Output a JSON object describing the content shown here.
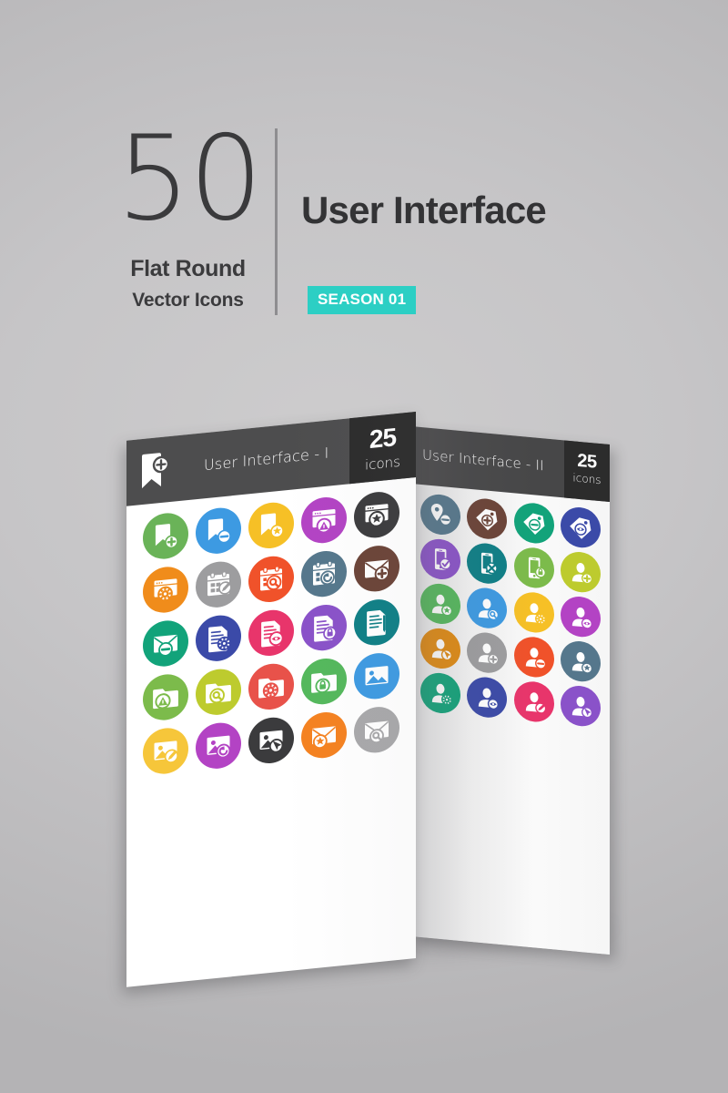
{
  "header": {
    "count": "50",
    "line1": "Flat Round",
    "line2": "Vector Icons",
    "title": "User Interface",
    "season_badge": "SEASON 01",
    "accent_color": "#2ccfc4",
    "text_color": "#333335"
  },
  "cards": [
    {
      "id": "card-1",
      "title": "User Interface - I",
      "count_number": "25",
      "count_label": "icons",
      "bar_color": "#4d4d4e",
      "badge_color": "#2b2b2b",
      "bookmark_icon": "bookmark-plus-icon",
      "icons": [
        {
          "name": "bookmark-add-icon",
          "color": "#6ab358"
        },
        {
          "name": "bookmark-remove-icon",
          "color": "#3d9ae2"
        },
        {
          "name": "bookmark-star-icon",
          "color": "#f6c026"
        },
        {
          "name": "browser-warning-icon",
          "color": "#b343c4"
        },
        {
          "name": "browser-star-icon",
          "color": "#3b3b3d"
        },
        {
          "name": "browser-settings-icon",
          "color": "#f08c1b"
        },
        {
          "name": "calendar-edit-icon",
          "color": "#9d9d9f"
        },
        {
          "name": "calendar-search-icon",
          "color": "#f0522a"
        },
        {
          "name": "calendar-refresh-icon",
          "color": "#55778c"
        },
        {
          "name": "mail-add-icon",
          "color": "#6b4337"
        },
        {
          "name": "mail-remove-icon",
          "color": "#12a37a"
        },
        {
          "name": "document-settings-icon",
          "color": "#3b4aa8"
        },
        {
          "name": "document-view-icon",
          "color": "#e8356b"
        },
        {
          "name": "document-lock-icon",
          "color": "#8a52c9"
        },
        {
          "name": "document-edit-icon",
          "color": "#0e7f86"
        },
        {
          "name": "folder-alert-icon",
          "color": "#7cbb4b"
        },
        {
          "name": "folder-search-icon",
          "color": "#bdcb2e"
        },
        {
          "name": "folder-settings-icon",
          "color": "#e8524a"
        },
        {
          "name": "folder-lock-icon",
          "color": "#54b85c"
        },
        {
          "name": "image-icon",
          "color": "#3d9ae2"
        },
        {
          "name": "image-edit-icon",
          "color": "#f6c63a"
        },
        {
          "name": "image-refresh-icon",
          "color": "#b343c4"
        },
        {
          "name": "image-click-icon",
          "color": "#3b3b3d"
        },
        {
          "name": "mail-star-icon",
          "color": "#f58220"
        },
        {
          "name": "mail-search-icon",
          "color": "#a8a8aa"
        }
      ]
    },
    {
      "id": "card-2",
      "title": "User Interface - II",
      "count_number": "25",
      "count_label": "icons",
      "bar_color": "#474748",
      "badge_color": "#2c2c2c",
      "icons": [
        {
          "name": "location-remove-icon",
          "color": "#55778c"
        },
        {
          "name": "tag-add-icon",
          "color": "#6b4337"
        },
        {
          "name": "tag-remove-icon",
          "color": "#12a37a"
        },
        {
          "name": "tag-view-icon",
          "color": "#3b4aa8"
        },
        {
          "name": "mobile-check-icon",
          "color": "#8a52c9"
        },
        {
          "name": "mobile-cancel-icon",
          "color": "#0e7f86"
        },
        {
          "name": "mobile-lock-icon",
          "color": "#7cbb4b"
        },
        {
          "name": "user-add-icon",
          "color": "#bdcb2e"
        },
        {
          "name": "user-star-icon",
          "color": "#54b85c"
        },
        {
          "name": "user-search-icon",
          "color": "#3d9ae2"
        },
        {
          "name": "user-settings-icon",
          "color": "#f6c026"
        },
        {
          "name": "user-view-icon",
          "color": "#b343c4"
        },
        {
          "name": "user-click-icon",
          "color": "#e08a12"
        },
        {
          "name": "user-plus-icon",
          "color": "#9d9d9f"
        },
        {
          "name": "user-minus-icon",
          "color": "#f0522a"
        },
        {
          "name": "user-favorite-icon",
          "color": "#55778c"
        },
        {
          "name": "user-gear-icon",
          "color": "#12a37a"
        },
        {
          "name": "user-eye-icon",
          "color": "#3b4aa8"
        },
        {
          "name": "user-edit-icon",
          "color": "#e8356b"
        },
        {
          "name": "user-cursor-icon",
          "color": "#8a52c9"
        }
      ]
    }
  ]
}
